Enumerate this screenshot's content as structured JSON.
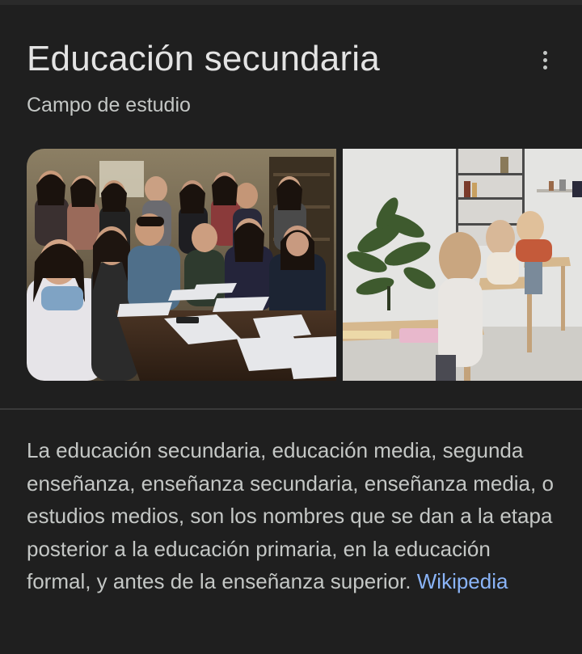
{
  "knowledge_panel": {
    "title": "Educación secundaria",
    "subtitle": "Campo de estudio",
    "more_options_icon": "more-vert-icon",
    "images": [
      {
        "name": "students-group-photo"
      },
      {
        "name": "classroom-desks-photo"
      }
    ],
    "description": "La educación secundaria, educación media, segunda enseñanza, enseñanza secundaria, enseñanza media, o estudios medios, son los nombres que se dan a la etapa posterior a la educación primaria, en la educación formal, y antes de la enseñanza superior.",
    "source_link": "Wikipedia"
  },
  "colors": {
    "background": "#1f1f1f",
    "title_text": "#e3e3e3",
    "body_text": "#c4c7c5",
    "link": "#8ab4f8"
  }
}
